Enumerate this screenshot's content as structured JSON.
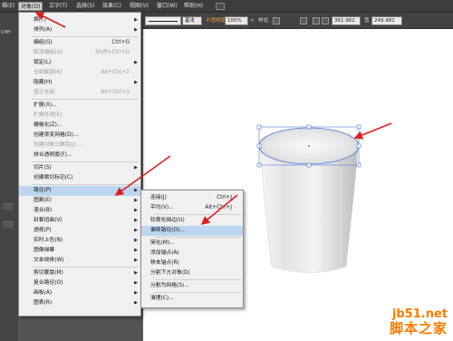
{
  "menubar": {
    "items": [
      "辑(E)",
      "对象(O)",
      "文字(T)",
      "选择(S)",
      "效果(C)",
      "视图(V)",
      "窗口(W)",
      "帮助(H)"
    ],
    "active": "对象(O)"
  },
  "controlbar": {
    "stroke_style": "基本",
    "opacity_label": "不透明度",
    "opacity_value": "100%",
    "style_label": "样式",
    "x_value": "361.962",
    "width_label": "宽",
    "width_value": "249.481"
  },
  "document_tab": "CMY",
  "object_menu": [
    {
      "label": "换(T)",
      "arrow": true
    },
    {
      "label": "排列(A)",
      "arrow": true
    },
    {
      "sep": true
    },
    {
      "label": "编组(G)",
      "shortcut": "Ctrl+G"
    },
    {
      "label": "取消编组(U)",
      "shortcut": "Shift+Ctrl+G",
      "disabled": true
    },
    {
      "label": "锁定(L)",
      "arrow": true
    },
    {
      "label": "全部解锁(K)",
      "shortcut": "Alt+Ctrl+2",
      "disabled": true
    },
    {
      "label": "隐藏(H)",
      "arrow": true
    },
    {
      "label": "显示全部",
      "shortcut": "Alt+Ctrl+3",
      "disabled": true
    },
    {
      "sep": true
    },
    {
      "label": "扩展(X)..."
    },
    {
      "label": "扩展外观(E)",
      "disabled": true
    },
    {
      "label": "栅格化(Z)..."
    },
    {
      "label": "创建渐变网格(D)..."
    },
    {
      "label": "创建对象马赛克(J)...",
      "disabled": true
    },
    {
      "label": "拼合透明度(F)..."
    },
    {
      "sep": true
    },
    {
      "label": "切片(S)",
      "arrow": true
    },
    {
      "label": "创建裁切标记(C)"
    },
    {
      "sep": true
    },
    {
      "label": "路径(P)",
      "arrow": true,
      "highlight": true
    },
    {
      "label": "图案(E)",
      "arrow": true
    },
    {
      "label": "混合(B)",
      "arrow": true
    },
    {
      "label": "封套扭曲(V)",
      "arrow": true
    },
    {
      "label": "透视(P)",
      "arrow": true
    },
    {
      "label": "实时上色(N)",
      "arrow": true
    },
    {
      "label": "图像描摹",
      "arrow": true
    },
    {
      "label": "文本绕排(W)",
      "arrow": true
    },
    {
      "sep": true
    },
    {
      "label": "剪切蒙版(M)",
      "arrow": true
    },
    {
      "label": "复合路径(O)",
      "arrow": true
    },
    {
      "label": "画板(A)",
      "arrow": true
    },
    {
      "label": "图表(R)",
      "arrow": true
    }
  ],
  "path_submenu": [
    {
      "label": "连接(J)",
      "shortcut": "Ctrl+J"
    },
    {
      "label": "平均(V)...",
      "shortcut": "Alt+Ctrl+J"
    },
    {
      "sep": true
    },
    {
      "label": "轮廓化描边(U)"
    },
    {
      "label": "偏移路径(O)...",
      "highlight": true
    },
    {
      "sep": true
    },
    {
      "label": "简化(M)..."
    },
    {
      "label": "添加锚点(A)"
    },
    {
      "label": "移去锚点(R)"
    },
    {
      "label": "分割下方对象(D)"
    },
    {
      "sep": true
    },
    {
      "label": "分割为网格(S)..."
    },
    {
      "sep": true
    },
    {
      "label": "清理(C)..."
    }
  ],
  "watermark": {
    "site": "jb51.net",
    "name": "脚本之家"
  },
  "colors": {
    "highlight": "#bcd6f2",
    "arrow": "#e02020",
    "selection": "#4a7bd8",
    "watermark": "#ff7a00"
  }
}
